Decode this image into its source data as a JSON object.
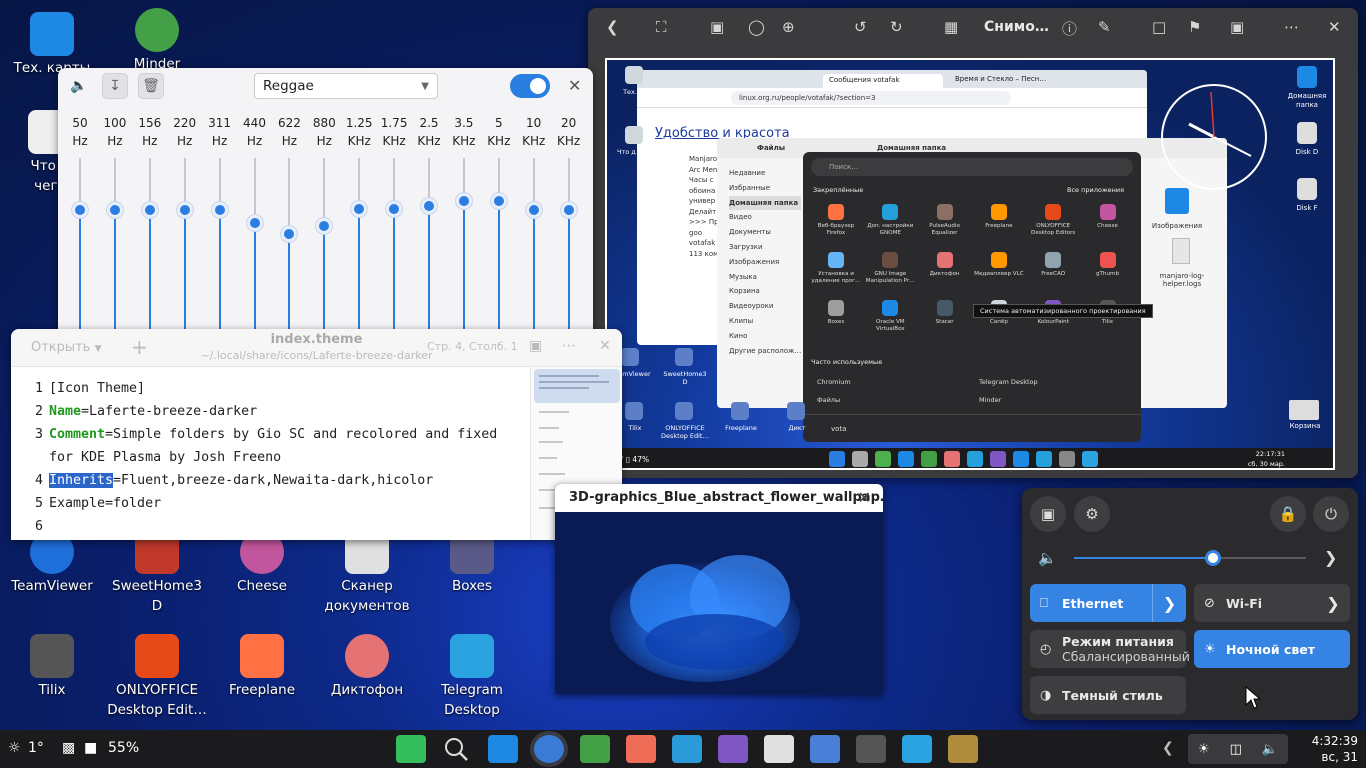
{
  "desktop_icons": [
    {
      "label": "Тех. карты",
      "icon": "map-icon",
      "color": "#1e88e5"
    },
    {
      "label": "Minder",
      "icon": "mindmap-icon",
      "color": "#43a047"
    },
    {
      "label": "Что д\nчего",
      "icon": "document-icon",
      "color": "#eeeeee"
    },
    {
      "label": "TeamViewer",
      "icon": "teamviewer-icon",
      "color": "#1e6fd9"
    },
    {
      "label": "SweetHome3\nD",
      "icon": "house-icon",
      "color": "#c0392b"
    },
    {
      "label": "Cheese",
      "icon": "camera-icon",
      "color": "#c2569e"
    },
    {
      "label": "Сканер\nдокументов",
      "icon": "scanner-icon",
      "color": "#e0e0e0"
    },
    {
      "label": "Boxes",
      "icon": "boxes-icon",
      "color": "#5a5a88"
    },
    {
      "label": "Tilix",
      "icon": "terminal-icon",
      "color": "#555555"
    },
    {
      "label": "ONLYOFFICE\nDesktop Edit…",
      "icon": "onlyoffice-icon",
      "color": "#e64a19"
    },
    {
      "label": "Freeplane",
      "icon": "freeplane-icon",
      "color": "#ff7043"
    },
    {
      "label": "Диктофон",
      "icon": "recorder-icon",
      "color": "#e57373"
    },
    {
      "label": "Telegram\nDesktop",
      "icon": "telegram-icon",
      "color": "#2aa3e0"
    }
  ],
  "equalizer": {
    "preset": "Reggae",
    "enabled": true,
    "bands": [
      {
        "freq": "50",
        "unit": "Hz",
        "level": 0.5
      },
      {
        "freq": "100",
        "unit": "Hz",
        "level": 0.5
      },
      {
        "freq": "156",
        "unit": "Hz",
        "level": 0.5
      },
      {
        "freq": "220",
        "unit": "Hz",
        "level": 0.5
      },
      {
        "freq": "311",
        "unit": "Hz",
        "level": 0.5
      },
      {
        "freq": "440",
        "unit": "Hz",
        "level": 0.41
      },
      {
        "freq": "622",
        "unit": "Hz",
        "level": 0.33
      },
      {
        "freq": "880",
        "unit": "Hz",
        "level": 0.39
      },
      {
        "freq": "1.25",
        "unit": "KHz",
        "level": 0.51
      },
      {
        "freq": "1.75",
        "unit": "KHz",
        "level": 0.51
      },
      {
        "freq": "2.5",
        "unit": "KHz",
        "level": 0.53
      },
      {
        "freq": "3.5",
        "unit": "KHz",
        "level": 0.56
      },
      {
        "freq": "5",
        "unit": "KHz",
        "level": 0.56
      },
      {
        "freq": "10",
        "unit": "KHz",
        "level": 0.5
      },
      {
        "freq": "20",
        "unit": "KHz",
        "level": 0.5
      }
    ]
  },
  "editor": {
    "open_label": "Открыть",
    "title": "index.theme",
    "path": "~/.local/share/icons/Laferte-breeze-darker",
    "position": "Стр. 4, Столб. 1",
    "lines": [
      {
        "num": "1",
        "key": "",
        "rest": "[Icon Theme]"
      },
      {
        "num": "2",
        "key": "Name",
        "rest": "=Laferte-breeze-darker"
      },
      {
        "num": "3",
        "key": "Comment",
        "rest": "=Simple folders by Gio SC and recolored and fixed"
      },
      {
        "num": "",
        "key": "",
        "rest": "for KDE Plasma by Josh Freeno"
      },
      {
        "num": "4",
        "key": "Inherits",
        "rest": "=Fluent,breeze-dark,Newaita-dark,hicolor",
        "selected": true
      },
      {
        "num": "5",
        "key": "",
        "rest": "Example=folder"
      },
      {
        "num": "6",
        "key": "",
        "rest": ""
      }
    ]
  },
  "viewer": {
    "title": "Снимо…",
    "shot": {
      "tabs": [
        "Сообщения votafak",
        "Время и Стекло – Песн…"
      ],
      "url": "linux.org.ru/people/votafak/?section=3",
      "page_heading": "Удобство и красота",
      "page_lines": [
        "Manjaro",
        "Arc Men",
        "Часы с",
        "обоина",
        "универ",
        "Делайт",
        ">>> Пр",
        "goo",
        "votafak",
        "113 ком"
      ],
      "files_title": "Файлы",
      "files_location": "Домашняя папка",
      "sidebar": [
        "Недавние",
        "Избранные",
        "Домашняя папка",
        "Видео",
        "Документы",
        "Загрузки",
        "Изображения",
        "Музыка",
        "Корзина",
        "Видеоуроки",
        "Клипы",
        "Кино",
        "Другие располож…"
      ],
      "search_placeholder": "Поиск…",
      "pinned_label": "Закреплённые",
      "all_apps": "Все приложения",
      "apps": [
        "Веб-браузер Firefox",
        "Доп. настройки GNOME",
        "PulseAudio Equalizer",
        "Freeplane",
        "ONLYOFFICE Desktop Editors",
        "Cheese",
        "Установка и удаление прог…",
        "GNU Image Manipulation Pr…",
        "Диктофон",
        "Медиаплеер VLC",
        "FreeCAD",
        "gThumb",
        "Boxes",
        "Oracle VM VirtualBox",
        "Stacer",
        "Сапёр",
        "KolourPaint",
        "Tilix"
      ],
      "tooltip": "Система автоматизированного проектирования",
      "frequent_label": "Часто используемые",
      "frequent": [
        "Chromium",
        "Telegram Desktop",
        "Файлы",
        "Minder"
      ],
      "user": "vota",
      "right_icons": [
        "Домашняя папка",
        "Disk D",
        "Disk F",
        "Изображения",
        "manjaro-log-helper.logs",
        "Корзина"
      ],
      "left_icons": [
        "Тех. ка",
        "Что д чего",
        "TeamViewer",
        "SweetHome3 D",
        "Tilix",
        "ONLYOFFICE Desktop Edit…",
        "Freeplane",
        "Дикт"
      ],
      "panel_left": "1° ▯ 47%",
      "clock": "22:17:31",
      "date": "сб, 30 мар."
    }
  },
  "preview": {
    "title": "3D-graphics_Blue_abstract_flower_wallpap…"
  },
  "quick_settings": {
    "volume": 0.6,
    "tiles": [
      {
        "label": "Ethernet",
        "sub": "",
        "on": true,
        "icon": "ethernet-icon",
        "arrow": true
      },
      {
        "label": "Wi-Fi",
        "sub": "",
        "on": false,
        "icon": "wifi-icon",
        "arrow": true
      },
      {
        "label": "Режим питания",
        "sub": "Сбалансированный",
        "on": false,
        "icon": "power-mode-icon",
        "arrow": false
      },
      {
        "label": "Ночной свет",
        "sub": "",
        "on": true,
        "icon": "night-light-icon",
        "arrow": false
      },
      {
        "label": "Темный стиль",
        "sub": "",
        "on": false,
        "icon": "dark-style-icon",
        "arrow": false
      }
    ]
  },
  "panel": {
    "weather": "1°",
    "battery": "55%",
    "time": "4:32:39",
    "date": "вс, 31 мар."
  }
}
